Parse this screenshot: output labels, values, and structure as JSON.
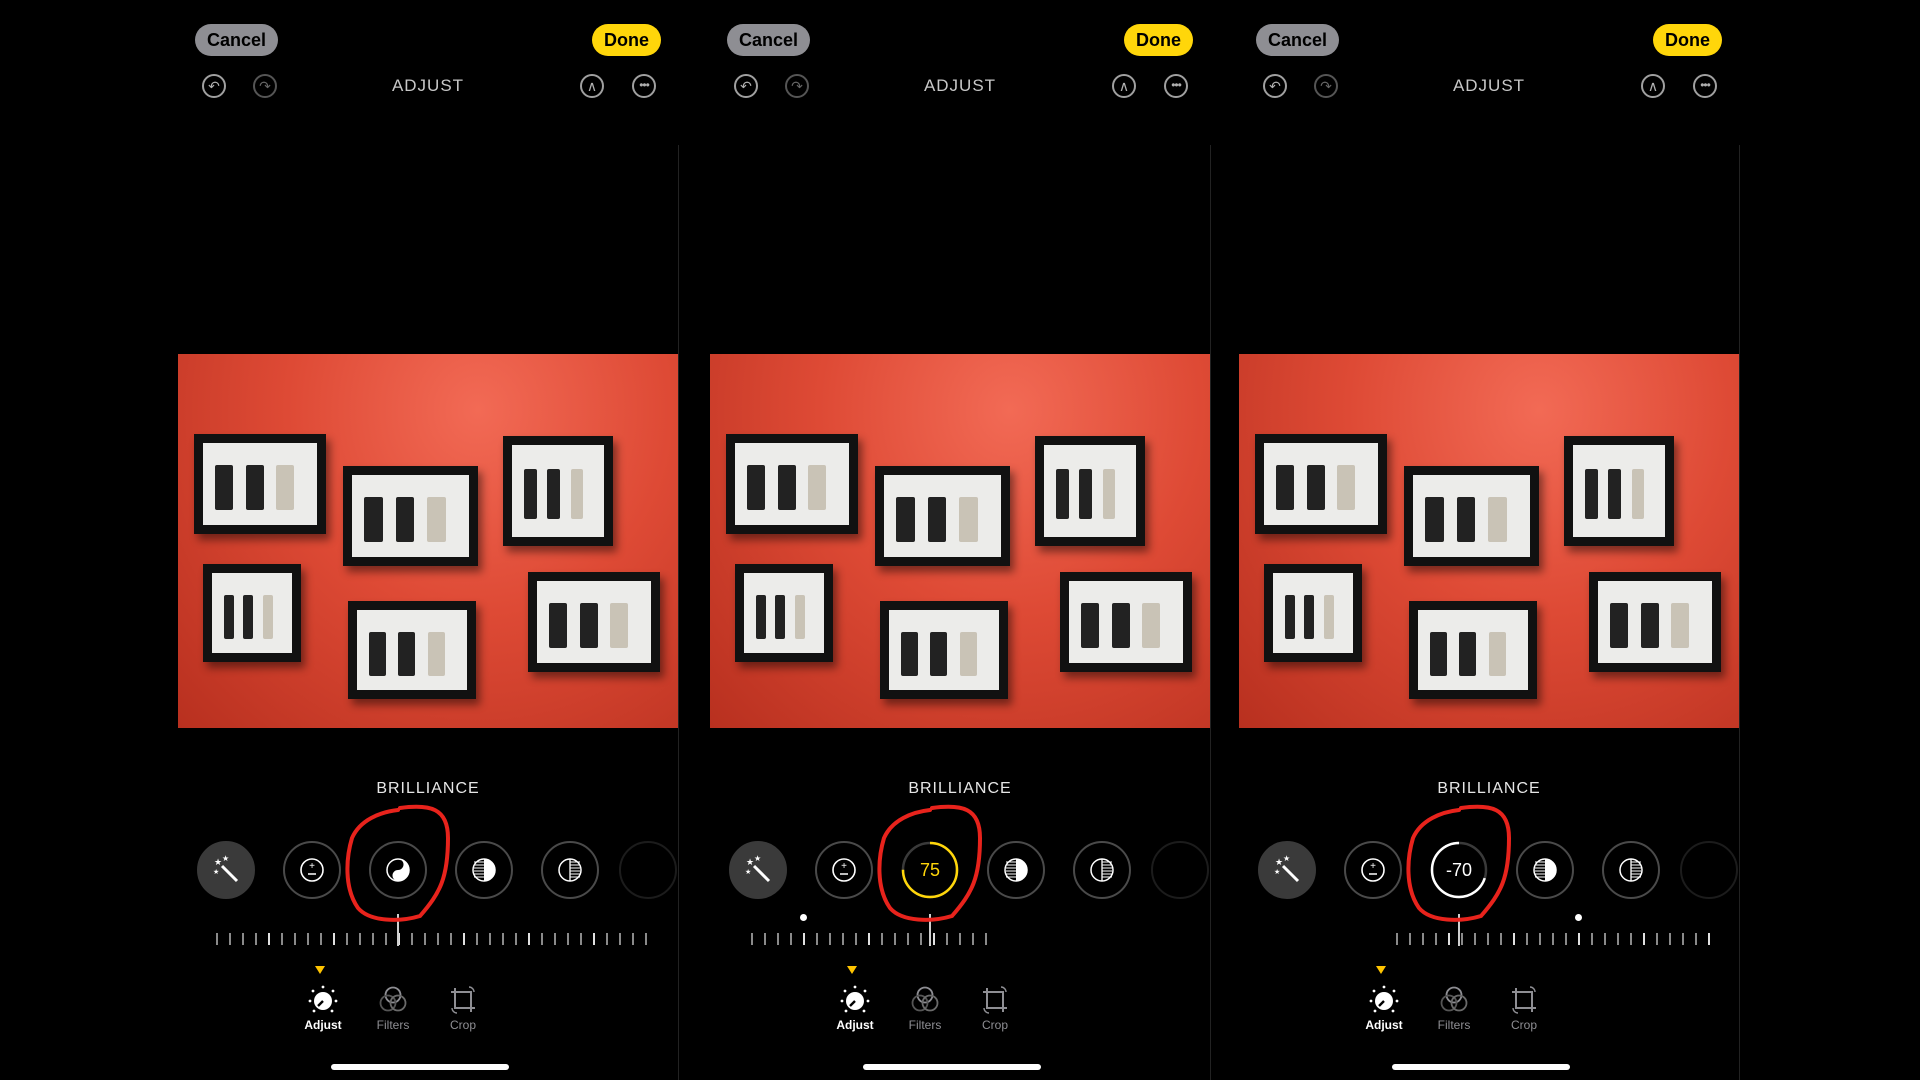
{
  "colors": {
    "accent": "#ffd60a",
    "annotation": "#e8231c",
    "background": "#000000",
    "photo_wall": "#de4a35"
  },
  "panels": [
    {
      "cancel_label": "Cancel",
      "done_label": "Done",
      "title": "ADJUST",
      "tool_label": "BRILLIANCE",
      "active_tool_value": "",
      "active_tool_icon": "brilliance-icon",
      "adjust_value_fraction": 0.5,
      "tools": [
        {
          "name": "auto-enhance",
          "icon": "magic-wand-icon"
        },
        {
          "name": "exposure",
          "icon": "exposure-plus-minus-icon"
        },
        {
          "name": "brilliance",
          "icon": "yin-yang-icon"
        },
        {
          "name": "highlights",
          "icon": "highlights-icon"
        },
        {
          "name": "shadows",
          "icon": "shadows-icon"
        }
      ],
      "tabs": [
        {
          "label": "Adjust",
          "icon": "adjust-dial-icon"
        },
        {
          "label": "Filters",
          "icon": "filters-circles-icon"
        },
        {
          "label": "Crop",
          "icon": "crop-rotate-icon"
        }
      ]
    },
    {
      "cancel_label": "Cancel",
      "done_label": "Done",
      "title": "ADJUST",
      "tool_label": "BRILLIANCE",
      "active_tool_value": "75",
      "active_tool_color": "#ffd60a",
      "adjust_value": 75,
      "tools": [
        {
          "name": "auto-enhance",
          "icon": "magic-wand-icon"
        },
        {
          "name": "exposure",
          "icon": "exposure-plus-minus-icon"
        },
        {
          "name": "brilliance",
          "icon": "yin-yang-icon"
        },
        {
          "name": "highlights",
          "icon": "highlights-icon"
        },
        {
          "name": "shadows",
          "icon": "shadows-icon"
        }
      ],
      "tabs": [
        {
          "label": "Adjust",
          "icon": "adjust-dial-icon"
        },
        {
          "label": "Filters",
          "icon": "filters-circles-icon"
        },
        {
          "label": "Crop",
          "icon": "crop-rotate-icon"
        }
      ]
    },
    {
      "cancel_label": "Cancel",
      "done_label": "Done",
      "title": "ADJUST",
      "tool_label": "BRILLIANCE",
      "active_tool_value": "-70",
      "active_tool_color": "#ffffff",
      "adjust_value": -70,
      "tools": [
        {
          "name": "auto-enhance",
          "icon": "magic-wand-icon"
        },
        {
          "name": "exposure",
          "icon": "exposure-plus-minus-icon"
        },
        {
          "name": "brilliance",
          "icon": "yin-yang-icon"
        },
        {
          "name": "highlights",
          "icon": "highlights-icon"
        },
        {
          "name": "shadows",
          "icon": "shadows-icon"
        }
      ],
      "tabs": [
        {
          "label": "Adjust",
          "icon": "adjust-dial-icon"
        },
        {
          "label": "Filters",
          "icon": "filters-circles-icon"
        },
        {
          "label": "Crop",
          "icon": "crop-rotate-icon"
        }
      ]
    }
  ]
}
